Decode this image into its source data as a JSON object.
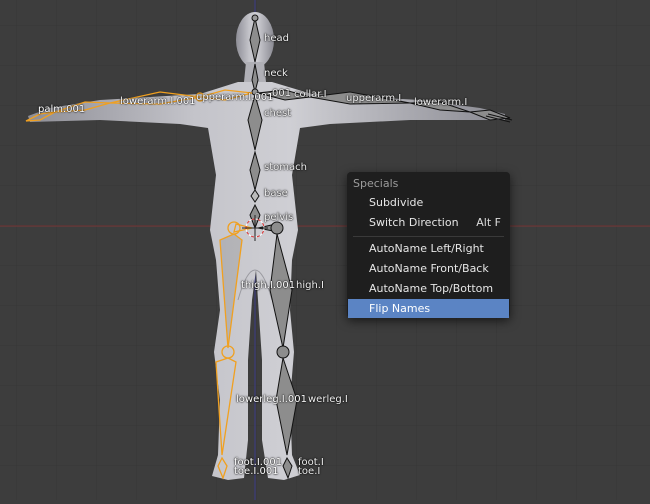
{
  "viewport": {
    "bone_labels": {
      "head": "head",
      "neck": "neck",
      "collar_r": "collar.I",
      "collar_l": "001",
      "chest": "chest",
      "upperarm_r": "upperarm.I",
      "upperarm_l": "upperarm.I.001",
      "lowerarm_r": "lowerarm.I",
      "lowerarm_l": "lowerarm.I.001",
      "palm_l": "palm.001",
      "stomach": "stomach",
      "base": "base",
      "pelvis": "pelvis",
      "thigh_l": "thigh.I.001",
      "thigh_r": "high.I",
      "lowerleg_l": "lowerleg.I.001",
      "lowerleg_r": "werleg.I",
      "foot_l": "foot.I.001",
      "foot_r": "foot.I",
      "toe_l": "toe.I.001",
      "toe_r": "toe.I"
    },
    "colors": {
      "background": "#3d3d3d",
      "grid": "#363636",
      "mesh": "#b7b7bd",
      "bone": "#8d8d8d",
      "selected": "#f0a020",
      "x_axis": "#8a3a3a",
      "y_axis": "#3a3a8a"
    }
  },
  "specials_menu": {
    "title": "Specials",
    "items": [
      {
        "label": "Subdivide",
        "shortcut": ""
      },
      {
        "label": "Switch Direction",
        "shortcut": "Alt F"
      },
      {
        "label": "AutoName Left/Right",
        "shortcut": ""
      },
      {
        "label": "AutoName Front/Back",
        "shortcut": ""
      },
      {
        "label": "AutoName Top/Bottom",
        "shortcut": ""
      },
      {
        "label": "Flip Names",
        "shortcut": ""
      }
    ],
    "highlight_color": "#5b84c4"
  }
}
